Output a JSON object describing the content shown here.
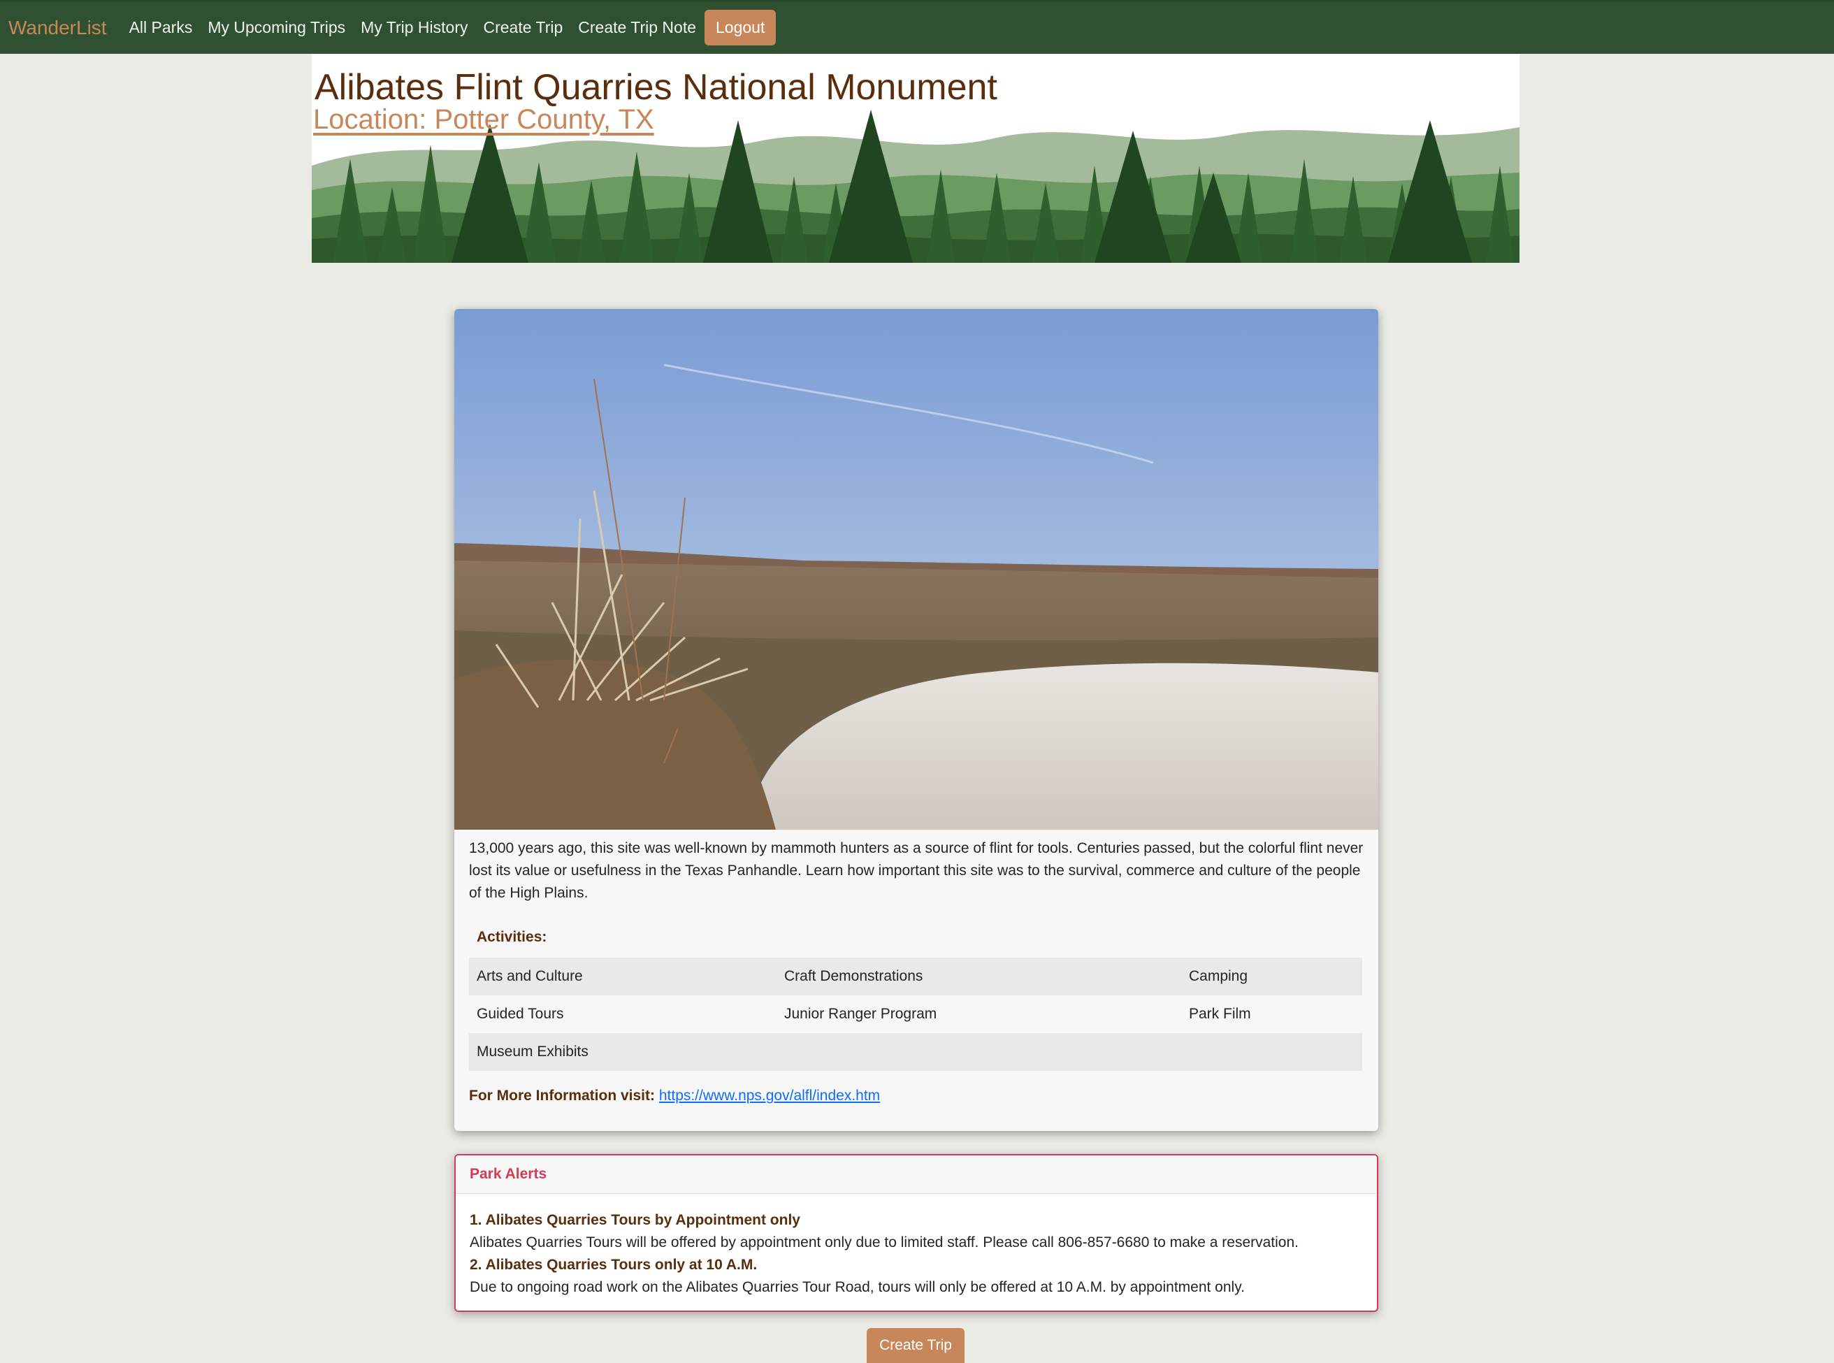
{
  "nav": {
    "brand": "WanderList",
    "links": [
      "All Parks",
      "My Upcoming Trips",
      "My Trip History",
      "Create Trip",
      "Create Trip Note"
    ],
    "logout": "Logout"
  },
  "park": {
    "title": "Alibates Flint Quarries National Monument",
    "location": "Location: Potter County, TX",
    "description": "13,000 years ago, this site was well-known by mammoth hunters as a source of flint for tools. Centuries passed, but the colorful flint never lost its value or usefulness in the Texas Panhandle. Learn how important this site was to the survival, commerce and culture of the people of the High Plains.",
    "activities_heading": "Activities:",
    "activities": [
      [
        "Arts and Culture",
        "Craft Demonstrations",
        "Camping"
      ],
      [
        "Guided Tours",
        "Junior Ranger Program",
        "Park Film"
      ],
      [
        "Museum Exhibits",
        "",
        ""
      ]
    ],
    "more_info_label": "For More Information visit:",
    "more_info_url": "https://www.nps.gov/alfl/index.htm"
  },
  "alerts": {
    "heading": "Park Alerts",
    "items": [
      {
        "title": "1. Alibates Quarries Tours by Appointment only",
        "body": "Alibates Quarries Tours will be offered by appointment only due to limited staff. Please call 806-857-6680 to make a reservation."
      },
      {
        "title": "2. Alibates Quarries Tours only at 10 A.M.",
        "body": "Due to ongoing road work on the Alibates Quarries Tour Road, tours will only be offered at 10 A.M. by appointment only."
      }
    ]
  },
  "actions": {
    "create_trip": "Create Trip"
  },
  "colors": {
    "nav_bg": "#2f5131",
    "accent": "#c8875a",
    "title_brown": "#5a2e0c",
    "alert_red": "#d43a55",
    "link_blue": "#0d6efd",
    "page_bg": "#ebebe6"
  }
}
